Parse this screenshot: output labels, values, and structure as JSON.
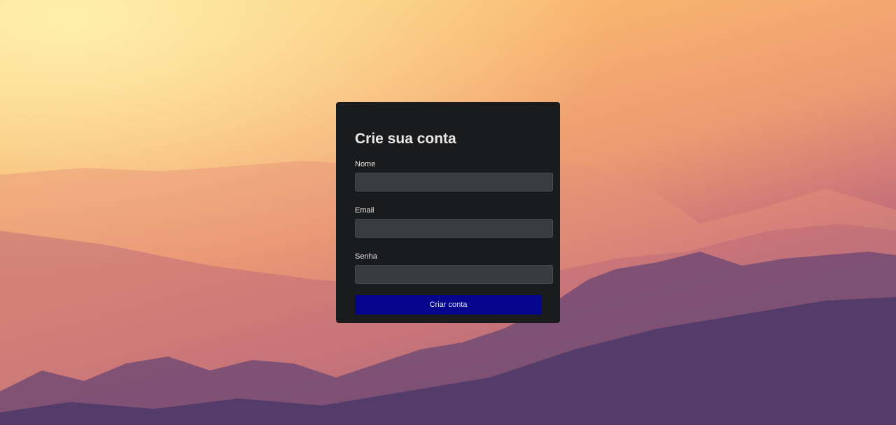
{
  "form": {
    "title": "Crie sua conta",
    "fields": [
      {
        "label": "Nome",
        "value": "",
        "type": "text"
      },
      {
        "label": "Email",
        "value": "",
        "type": "email"
      },
      {
        "label": "Senha",
        "value": "",
        "type": "password"
      }
    ],
    "submit_label": "Criar conta"
  },
  "colors": {
    "card_background": "#1a1b1d",
    "input_background": "#3a3b3d",
    "button_background": "#04048c",
    "text": "#e6e6e6"
  }
}
